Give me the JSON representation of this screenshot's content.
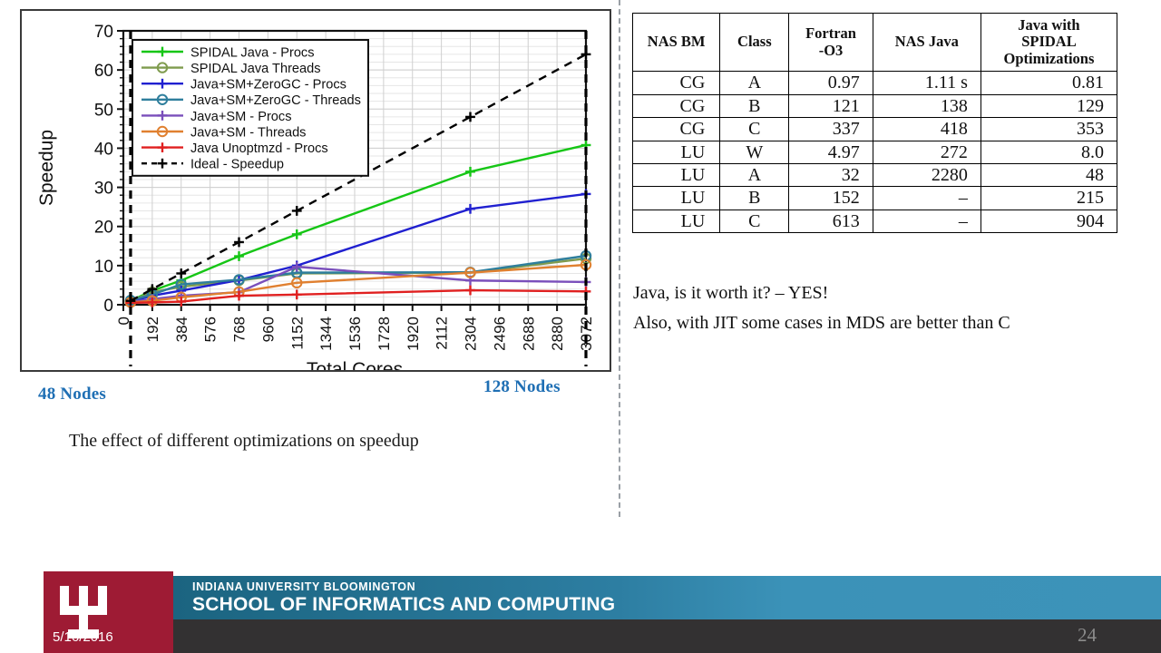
{
  "slide": {
    "caption": "The effect of different optimizations on speedup",
    "node_label_left": "48 Nodes",
    "node_label_right": "128 Nodes",
    "note_1": "Java, is it worth it? – YES!",
    "note_2": "Also, with JIT some cases in MDS are better than C",
    "slide_number": "24",
    "date": "5/16/2016"
  },
  "footer": {
    "line1": "INDIANA UNIVERSITY BLOOMINGTON",
    "line2": "SCHOOL OF INFORMATICS AND COMPUTING",
    "crimson": "#9e1b34",
    "teal_dark": "#1b6480",
    "teal_light": "#3d93b9",
    "bar_dark": "#333132"
  },
  "table": {
    "headers": [
      "NAS BM",
      "Class",
      "Fortran\n-O3",
      "NAS Java",
      "Java with SPIDAL Optimizations"
    ],
    "header_lines": [
      [
        "NAS BM"
      ],
      [
        "Class"
      ],
      [
        "Fortran",
        "-O3"
      ],
      [
        "NAS Java"
      ],
      [
        "Java with",
        "SPIDAL",
        "Optimizations"
      ]
    ],
    "rows": [
      {
        "bm": "CG",
        "class": "A",
        "fortran": "0.97",
        "nas_java": "1.11 s",
        "spidal": "0.81"
      },
      {
        "bm": "CG",
        "class": "B",
        "fortran": "121",
        "nas_java": "138",
        "spidal": "129"
      },
      {
        "bm": "CG",
        "class": "C",
        "fortran": "337",
        "nas_java": "418",
        "spidal": "353"
      },
      {
        "bm": "LU",
        "class": "W",
        "fortran": "4.97",
        "nas_java": "272",
        "spidal": "8.0"
      },
      {
        "bm": "LU",
        "class": "A",
        "fortran": "32",
        "nas_java": "2280",
        "spidal": "48"
      },
      {
        "bm": "LU",
        "class": "B",
        "fortran": "152",
        "nas_java": "–",
        "spidal": "215"
      },
      {
        "bm": "LU",
        "class": "C",
        "fortran": "613",
        "nas_java": "–",
        "spidal": "904"
      }
    ]
  },
  "chart_data": {
    "type": "line",
    "title": "",
    "xlabel": "Total Cores",
    "ylabel": "Speedup",
    "xlim": [
      0,
      3072
    ],
    "ylim": [
      0,
      70
    ],
    "ytick_step": 10,
    "yticks": [
      0,
      10,
      20,
      30,
      40,
      50,
      60,
      70
    ],
    "xticks": [
      0,
      192,
      384,
      576,
      768,
      960,
      1152,
      1344,
      1536,
      1728,
      1920,
      2112,
      2304,
      2496,
      2688,
      2880,
      3072
    ],
    "grid": true,
    "legend_position": "top-left",
    "x": [
      48,
      192,
      384,
      768,
      1152,
      2304,
      3072
    ],
    "series": [
      {
        "name": "SPIDAL Java - Procs",
        "color": "#16c616",
        "marker": "plus",
        "dash": false,
        "values": [
          1.0,
          3.6,
          6.2,
          12.4,
          18.0,
          34.0,
          40.8
        ]
      },
      {
        "name": "SPIDAL Java Threads",
        "color": "#7f9b4e",
        "marker": "circle",
        "dash": false,
        "values": [
          0.9,
          3.2,
          4.6,
          6.2,
          8.0,
          8.2,
          11.8
        ]
      },
      {
        "name": "Java+SM+ZeroGC - Procs",
        "color": "#2020d0",
        "marker": "plus",
        "dash": false,
        "values": [
          0.8,
          2.3,
          3.6,
          6.3,
          10.0,
          24.5,
          28.3
        ]
      },
      {
        "name": "Java+SM+ZeroGC - Threads",
        "color": "#2e7e9c",
        "marker": "circle",
        "dash": false,
        "values": [
          1.1,
          2.6,
          5.2,
          6.4,
          8.2,
          8.3,
          12.5
        ]
      },
      {
        "name": "Java+SM - Procs",
        "color": "#7a4fbb",
        "marker": "plus",
        "dash": false,
        "values": [
          0.7,
          1.4,
          2.3,
          3.2,
          9.7,
          6.2,
          5.8
        ]
      },
      {
        "name": "Java+SM - Threads",
        "color": "#e08030",
        "marker": "circle",
        "dash": false,
        "values": [
          0.6,
          1.0,
          1.9,
          3.3,
          5.6,
          8.2,
          10.2
        ]
      },
      {
        "name": "Java Unoptmzd - Procs",
        "color": "#e02020",
        "marker": "plus",
        "dash": false,
        "values": [
          0.5,
          0.6,
          0.8,
          2.3,
          2.6,
          3.7,
          3.4
        ]
      },
      {
        "name": "Ideal - Speedup",
        "color": "#000000",
        "marker": "plus",
        "dash": true,
        "values": [
          1.0,
          4.0,
          8.0,
          16.0,
          24.0,
          48.0,
          64.0
        ]
      }
    ],
    "annotations": [
      {
        "label": "48 Nodes",
        "x": 48,
        "type": "vline"
      },
      {
        "label": "128 Nodes",
        "x": 3072,
        "type": "vline"
      }
    ]
  }
}
